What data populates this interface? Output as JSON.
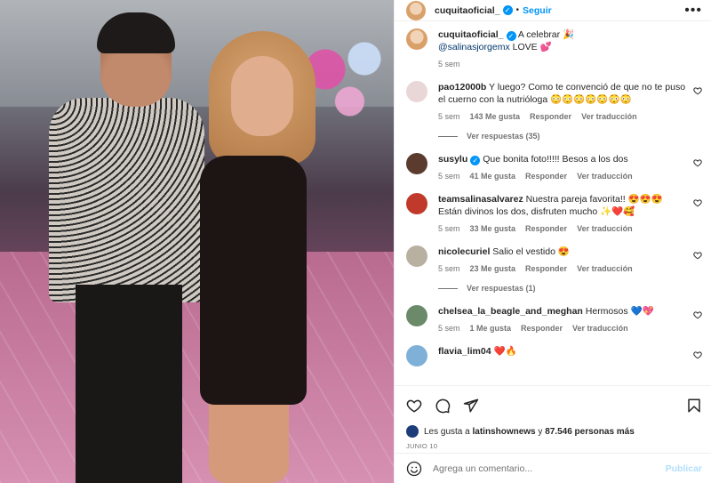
{
  "header": {
    "username": "cuquitaoficial_",
    "follow_label": "Seguir",
    "more_label": "•••"
  },
  "caption": {
    "username": "cuquitaoficial_",
    "text_before": "A celebrar 🎉",
    "mention": "@salinasjorgemx",
    "text_after": "LOVE 💕",
    "time": "5 sem"
  },
  "comments": [
    {
      "username": "pao12000b",
      "text": "Y luego? Como te convenció de que no te puso el cuerno con la nutrióloga 😳😳😳😳😳😳😳",
      "time": "5 sem",
      "likes": "143 Me gusta",
      "reply": "Responder",
      "translate": "Ver traducción",
      "view_replies": "Ver respuestas (35)",
      "verified": false,
      "avatar_color": "#e9d6d6"
    },
    {
      "username": "susylu",
      "text": "Que bonita foto!!!!! Besos a los dos",
      "time": "5 sem",
      "likes": "41 Me gusta",
      "reply": "Responder",
      "translate": "Ver traducción",
      "view_replies": "",
      "verified": true,
      "avatar_color": "#5a3b2e"
    },
    {
      "username": "teamsalinasalvarez",
      "text": "Nuestra pareja favorita!! 😍😍😍 Están divinos los dos, disfruten mucho ✨❤️🥰",
      "time": "5 sem",
      "likes": "33 Me gusta",
      "reply": "Responder",
      "translate": "Ver traducción",
      "view_replies": "",
      "verified": false,
      "avatar_color": "#c0392b"
    },
    {
      "username": "nicolecuriel",
      "text": "Salio el vestido 😍",
      "time": "5 sem",
      "likes": "23 Me gusta",
      "reply": "Responder",
      "translate": "Ver traducción",
      "view_replies": "Ver respuestas (1)",
      "verified": false,
      "avatar_color": "#b8b0a0"
    },
    {
      "username": "chelsea_la_beagle_and_meghan",
      "text": "Hermosos 💙💖",
      "time": "5 sem",
      "likes": "1 Me gusta",
      "reply": "Responder",
      "translate": "Ver traducción",
      "view_replies": "",
      "verified": false,
      "avatar_color": "#6a8a6a"
    },
    {
      "username": "flavia_lim04",
      "text": "❤️🔥",
      "time": "",
      "likes": "",
      "reply": "",
      "translate": "",
      "view_replies": "",
      "verified": false,
      "avatar_color": "#7fb0d8"
    }
  ],
  "likes": {
    "prefix": "Les gusta a",
    "user": "latinshownews",
    "middle": "y",
    "count": "87.546 personas más"
  },
  "date": "JUNIO 10",
  "add_comment": {
    "placeholder": "Agrega un comentario...",
    "post_label": "Publicar"
  },
  "colors": {
    "accent": "#0095f6",
    "muted": "#737373",
    "mention": "#00376b"
  }
}
